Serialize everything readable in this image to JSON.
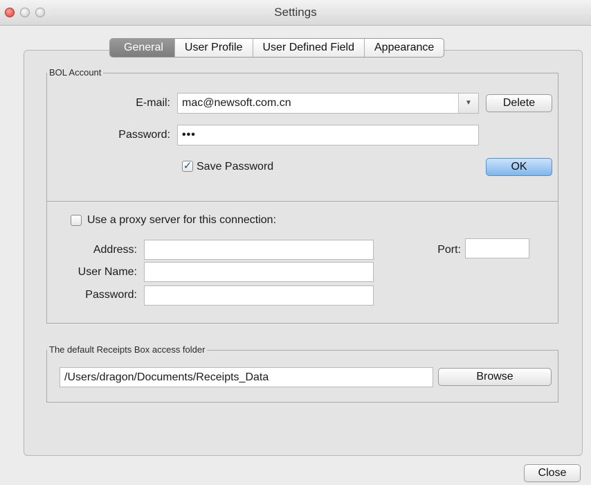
{
  "window": {
    "title": "Settings"
  },
  "tabs": [
    "General",
    "User Profile",
    "User Defined Field",
    "Appearance"
  ],
  "active_tab": "General",
  "bol_account": {
    "legend": "BOL Account",
    "email_label": "E-mail:",
    "email_value": "mac@newsoft.com.cn",
    "delete_label": "Delete",
    "password_label": "Password:",
    "password_value": "•••",
    "save_password_label": "Save Password",
    "save_password_checked": true,
    "ok_label": "OK",
    "proxy_label": "Use a proxy server for this connection:",
    "proxy_checked": false,
    "address_label": "Address:",
    "port_label": "Port:",
    "username_label": "User Name:",
    "proxy_password_label": "Password:"
  },
  "receipts": {
    "legend": "The default Receipts Box access folder",
    "path_value": "/Users/dragon/Documents/Receipts_Data",
    "browse_label": "Browse"
  },
  "footer": {
    "close_label": "Close"
  },
  "colors": {
    "default_button": "#7eb6ed",
    "active_tab": "#8a8a8a",
    "close_light": "#d8413a"
  }
}
